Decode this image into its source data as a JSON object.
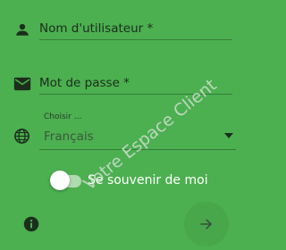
{
  "form": {
    "username": {
      "placeholder": "Nom d'utilisateur *",
      "icon": "person-icon"
    },
    "password": {
      "placeholder": "Mot de passe *",
      "icon": "envelope-icon"
    },
    "language": {
      "label": "Choisir ...",
      "value": "Français",
      "icon": "globe-icon",
      "dropdown_icon": "caret-down-icon"
    },
    "remember": {
      "label": "Se souvenir de moi",
      "enabled": false
    },
    "info_icon": "info-icon",
    "submit_icon": "arrow-right-icon"
  },
  "watermark": "Votre Espace Client",
  "colors": {
    "background": "#4caf50",
    "text": "#1b2e1b",
    "muted_text": "#3b5a3b",
    "toggle_label": "#ffffff"
  }
}
